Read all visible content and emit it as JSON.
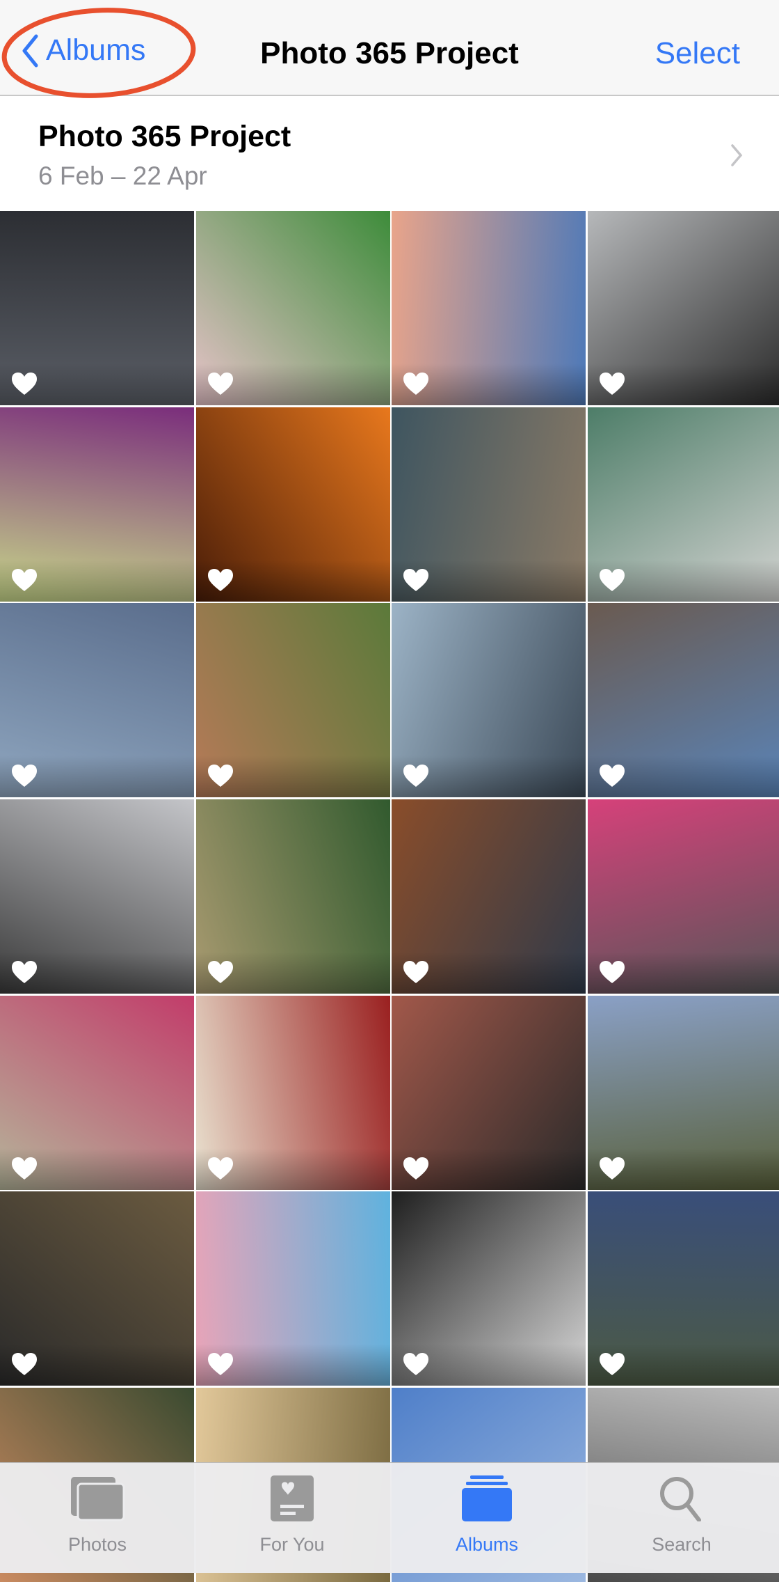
{
  "nav": {
    "back_label": "Albums",
    "title": "Photo 365 Project",
    "select_label": "Select"
  },
  "album": {
    "title": "Photo 365 Project",
    "date_range": "6 Feb – 22 Apr"
  },
  "accent": "#3478f6",
  "annotation_color": "#e8502e",
  "photos": [
    {
      "c1": "#5a5e66",
      "c2": "#2c2e33"
    },
    {
      "c1": "#e7c3c9",
      "c2": "#3d8c3a"
    },
    {
      "c1": "#e9a48a",
      "c2": "#4e79b8"
    },
    {
      "c1": "#b6b8ba",
      "c2": "#2a2a2a"
    },
    {
      "c1": "#7a2d7c",
      "c2": "#c8d88a"
    },
    {
      "c1": "#e8781d",
      "c2": "#4a1d08"
    },
    {
      "c1": "#8a7a66",
      "c2": "#3e5560"
    },
    {
      "c1": "#d4d4d2",
      "c2": "#4d7d68"
    },
    {
      "c1": "#8fa6bf",
      "c2": "#5a6d8c"
    },
    {
      "c1": "#b67a58",
      "c2": "#5b7a3a"
    },
    {
      "c1": "#9cb3c6",
      "c2": "#3c4a58"
    },
    {
      "c1": "#6a5a50",
      "c2": "#5a84b8"
    },
    {
      "c1": "#c4c5c9",
      "c2": "#3a3a3a"
    },
    {
      "c1": "#315a2e",
      "c2": "#a89a70"
    },
    {
      "c1": "#2f3a4a",
      "c2": "#8a4d2a"
    },
    {
      "c1": "#555658",
      "c2": "#d6417a"
    },
    {
      "c1": "#b5b59a",
      "c2": "#c23c6a"
    },
    {
      "c1": "#e9e1cf",
      "c2": "#9a2020"
    },
    {
      "c1": "#a2584a",
      "c2": "#2a2a2a"
    },
    {
      "c1": "#8aa0c6",
      "c2": "#59603a"
    },
    {
      "c1": "#6b5b40",
      "c2": "#2a2a2a"
    },
    {
      "c1": "#5fb2de",
      "c2": "#e8a4b8"
    },
    {
      "c1": "#d8d8d8",
      "c2": "#1f1f1f"
    },
    {
      "c1": "#4c5a44",
      "c2": "#394e7a"
    },
    {
      "c1": "#c98a60",
      "c2": "#3a4a30"
    },
    {
      "c1": "#e2c89a",
      "c2": "#7a6a40"
    },
    {
      "c1": "#4f7fc9",
      "c2": "#9cb8e0"
    },
    {
      "c1": "#bcbcbc",
      "c2": "#4a4a4a"
    }
  ],
  "tabs": [
    {
      "label": "Photos",
      "icon": "photos-icon",
      "active": false
    },
    {
      "label": "For You",
      "icon": "for-you-icon",
      "active": false
    },
    {
      "label": "Albums",
      "icon": "albums-icon",
      "active": true
    },
    {
      "label": "Search",
      "icon": "search-icon",
      "active": false
    }
  ]
}
